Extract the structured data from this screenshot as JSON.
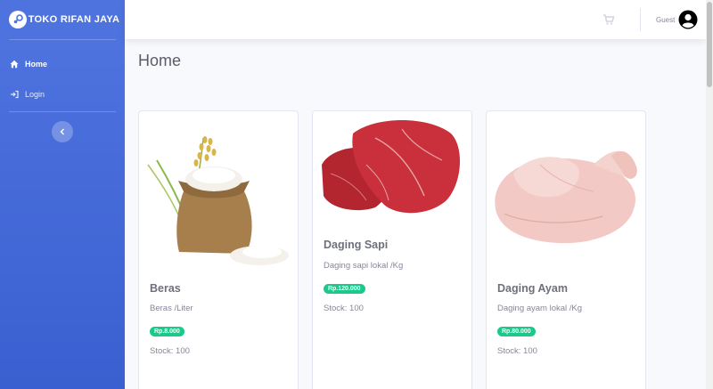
{
  "brand": {
    "name": "TOKO RIFAN JAYA"
  },
  "sidebar": {
    "items": [
      {
        "label": "Home",
        "icon": "home-icon",
        "active": true
      },
      {
        "label": "Login",
        "icon": "sign-in-icon",
        "active": false
      }
    ]
  },
  "topbar": {
    "user_name": "Guest"
  },
  "page": {
    "title": "Home"
  },
  "products": [
    {
      "name": "Beras",
      "desc": "Beras /Liter",
      "price": "Rp.8.000",
      "stock": "Stock: 100"
    },
    {
      "name": "Daging Sapi",
      "desc": "Daging sapi lokal /Kg",
      "price": "Rp.120.000",
      "stock": "Stock: 100"
    },
    {
      "name": "Daging Ayam",
      "desc": "Daging ayam lokal /Kg",
      "price": "Rp.80.000",
      "stock": "Stock: 100"
    }
  ],
  "colors": {
    "primary": "#4e73df",
    "success": "#1cc88a",
    "text": "#5a5c69"
  }
}
